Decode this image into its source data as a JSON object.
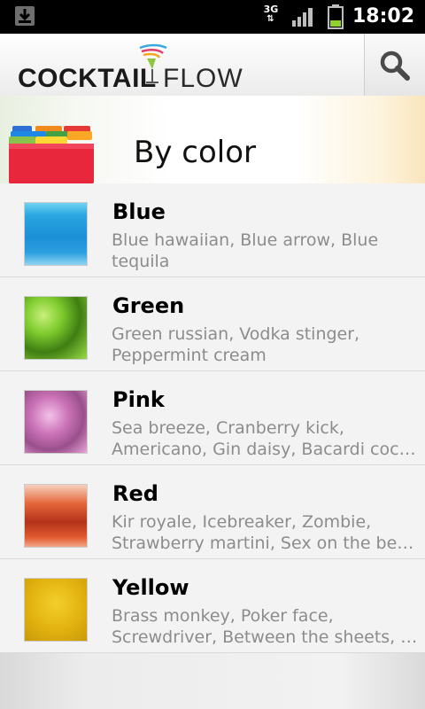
{
  "status_bar": {
    "network": "3G",
    "time": "18:02",
    "icons": [
      "download-icon",
      "network-3g-icon",
      "signal-icon",
      "battery-icon"
    ]
  },
  "app_bar": {
    "logo_left": "COCKTAIL",
    "logo_right": "FLOW",
    "logo_icon": "cocktail-glass-icon",
    "search_icon": "search-icon"
  },
  "header": {
    "title": "By color",
    "icon": "folder-tabs-icon"
  },
  "items": [
    {
      "title": "Blue",
      "line1": "Blue hawaiian, Blue arrow, Blue",
      "line2": "tequila"
    },
    {
      "title": "Green",
      "line1": "Green russian, Vodka stinger,",
      "line2": "Peppermint cream"
    },
    {
      "title": "Pink",
      "line1": "Sea breeze, Cranberry kick,",
      "line2": "Americano, Gin daisy, Bacardi cockt…"
    },
    {
      "title": "Red",
      "line1": "Kir royale, Icebreaker, Zombie,",
      "line2": "Strawberry martini, Sex on the bea…"
    },
    {
      "title": "Yellow",
      "line1": "Brass monkey, Poker face,",
      "line2": "Screwdriver, Between the sheets, B…"
    }
  ],
  "colors": {
    "status_bar_bg": "#000000",
    "title_text": "#000000",
    "description_text": "#8c8c8c"
  }
}
